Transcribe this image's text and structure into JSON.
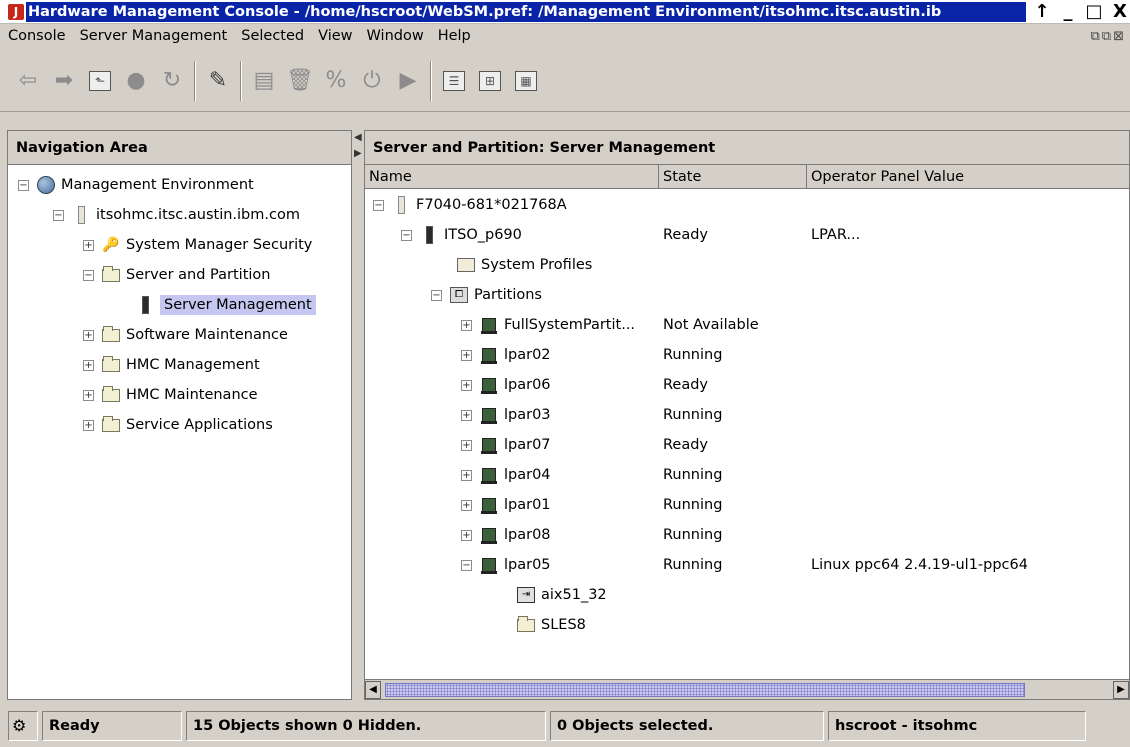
{
  "window": {
    "app_icon": "J",
    "title": "Hardware Management Console - /home/hscroot/WebSM.pref: /Management Environment/itsohmc.itsc.austin.ib",
    "controls": [
      "↑",
      "_",
      "□",
      "X"
    ]
  },
  "menubar": {
    "items": [
      "Console",
      "Server Management",
      "Selected",
      "View",
      "Window",
      "Help"
    ]
  },
  "toolbar": {
    "buttons": [
      "back-arrow-icon",
      "forward-arrow-icon",
      "up-folder-icon",
      "stop-icon",
      "refresh-icon",
      "find-icon",
      "properties-icon",
      "delete-icon",
      "percent-icon",
      "power-icon",
      "run-icon",
      "view-details-icon",
      "view-tree-icon",
      "view-tree-details-icon"
    ]
  },
  "navigation": {
    "header": "Navigation Area",
    "items": [
      {
        "label": "Management Environment",
        "toggle": "−"
      },
      {
        "label": "itsohmc.itsc.austin.ibm.com",
        "toggle": "−"
      },
      {
        "label": "System Manager Security",
        "toggle": "+"
      },
      {
        "label": "Server and Partition",
        "toggle": "−"
      },
      {
        "label": "Server Management",
        "toggle": ""
      },
      {
        "label": "Software Maintenance",
        "toggle": "+"
      },
      {
        "label": "HMC Management",
        "toggle": "+"
      },
      {
        "label": "HMC Maintenance",
        "toggle": "+"
      },
      {
        "label": "Service Applications",
        "toggle": "+"
      }
    ]
  },
  "main": {
    "header": "Server and Partition: Server Management",
    "columns": [
      "Name",
      "State",
      "Operator Panel Value"
    ],
    "rows": [
      {
        "name": "F7040-681*021768A",
        "state": "",
        "op": "",
        "toggle": "−"
      },
      {
        "name": "ITSO_p690",
        "state": "Ready",
        "op": "LPAR...",
        "toggle": "−"
      },
      {
        "name": "System Profiles",
        "state": "",
        "op": "",
        "toggle": ""
      },
      {
        "name": "Partitions",
        "state": "",
        "op": "",
        "toggle": "−"
      },
      {
        "name": "FullSystemPartit...",
        "state": "Not Available",
        "op": "",
        "toggle": "+"
      },
      {
        "name": "lpar02",
        "state": "Running",
        "op": "",
        "toggle": "+"
      },
      {
        "name": "lpar06",
        "state": "Ready",
        "op": "",
        "toggle": "+"
      },
      {
        "name": "lpar03",
        "state": "Running",
        "op": "",
        "toggle": "+"
      },
      {
        "name": "lpar07",
        "state": "Ready",
        "op": "",
        "toggle": "+"
      },
      {
        "name": "lpar04",
        "state": "Running",
        "op": "",
        "toggle": "+"
      },
      {
        "name": "lpar01",
        "state": "Running",
        "op": "",
        "toggle": "+"
      },
      {
        "name": "lpar08",
        "state": "Running",
        "op": "",
        "toggle": "+"
      },
      {
        "name": "lpar05",
        "state": "Running",
        "op": "Linux ppc64   2.4.19-ul1-ppc64",
        "toggle": "−"
      },
      {
        "name": "aix51_32",
        "state": "",
        "op": "",
        "toggle": ""
      },
      {
        "name": "SLES8",
        "state": "",
        "op": "",
        "toggle": ""
      }
    ]
  },
  "status": {
    "state": "Ready",
    "objects": "15 Objects shown 0 Hidden.",
    "selected": "0 Objects selected.",
    "user": "hscroot - itsohmc"
  }
}
